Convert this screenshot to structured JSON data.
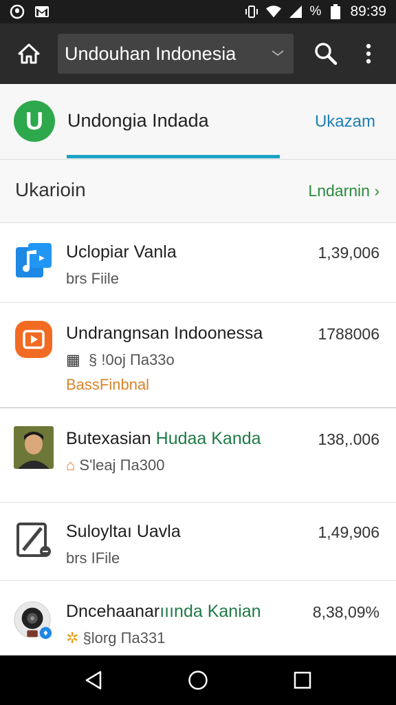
{
  "status_bar": {
    "time": "89:39",
    "battery_label": "%"
  },
  "toolbar": {
    "search_value": "Undouhan Indonesia"
  },
  "account": {
    "logo_letter": "U",
    "name": "Undongia Indada",
    "action": "Ukazam"
  },
  "section": {
    "title": "Ukarioin",
    "link": "Lndarnin ›"
  },
  "items": [
    {
      "title": "Uclopiar Vanla",
      "title_hl": "",
      "subtitle": "brs Fiile",
      "tag": "",
      "value": "1,39,006",
      "icon": "music-file-icon",
      "color": "#1e88e5"
    },
    {
      "title": "Undrangnsan Indoonessa",
      "title_hl": "",
      "subtitle": "  § !0oj Πa33ο",
      "tag": "BassFinbnal",
      "value": "1788006",
      "icon": "video-play-icon",
      "color": "#f26b22"
    },
    {
      "title": "Butexasian ",
      "title_hl": "Hudaa Kanda",
      "subtitle": "S'leaj Πa300",
      "tag": "",
      "value": "138,.006",
      "icon": "avatar-photo",
      "color": "#4a7a3a"
    },
    {
      "title": "Suloyltaı Uavla",
      "title_hl": "",
      "subtitle": "brs IFile",
      "tag": "",
      "value": "1,49,906",
      "icon": "edit-file-icon",
      "color": "#444444"
    },
    {
      "title": "Dncehaanar",
      "title_hl": "ııında Kanian",
      "subtitle": "§lorg Πa331",
      "tag": "",
      "value": "8,38,09%",
      "icon": "webcam-icon",
      "color": "#222222"
    }
  ]
}
